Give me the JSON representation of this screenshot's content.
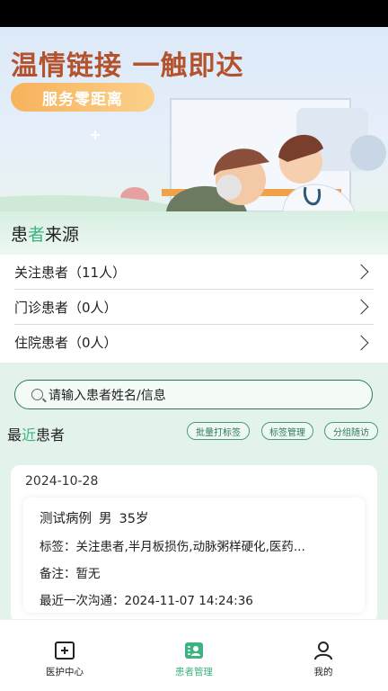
{
  "banner": {
    "title": "温情链接 一触即达",
    "pill": "服务零距离"
  },
  "source": {
    "title_a": "患",
    "title_b": "者",
    "title_c": "来源",
    "items": [
      {
        "label": "关注患者（11人）"
      },
      {
        "label": "门诊患者（0人）"
      },
      {
        "label": "住院患者（0人）"
      }
    ]
  },
  "search": {
    "placeholder": "请输入患者姓名/信息"
  },
  "recent": {
    "title_a": "最",
    "title_b": "近",
    "title_c": "患者",
    "buttons": [
      "批量打标签",
      "标签管理",
      "分组随访"
    ]
  },
  "card": {
    "date": "2024-10-28",
    "name": "测试病例",
    "gender": "男",
    "age": "35岁",
    "tags_label": "标签：",
    "tags": "关注患者,半月板损伤,动脉粥样硬化,医药...",
    "note_label": "备注：",
    "note": "暂无",
    "last_label": "最近一次沟通：",
    "last": "2024-11-07 14:24:36"
  },
  "tabbar": {
    "items": [
      {
        "label": "医护中心",
        "icon": "medical-plus-icon"
      },
      {
        "label": "患者管理",
        "icon": "patient-card-icon"
      },
      {
        "label": "我的",
        "icon": "user-icon"
      }
    ],
    "active_color": "#3fb37f"
  }
}
